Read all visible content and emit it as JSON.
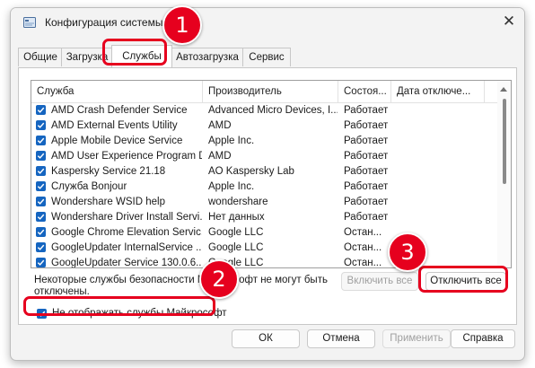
{
  "window": {
    "title": "Конфигурация системы",
    "close_glyph": "✕"
  },
  "tabs": [
    "Общие",
    "Загрузка",
    "Службы",
    "Автозагрузка",
    "Сервис"
  ],
  "active_tab": "Службы",
  "columns": [
    "Служба",
    "Производитель",
    "Состоя...",
    "Дата отключе..."
  ],
  "services": [
    {
      "name": "AMD Crash Defender Service",
      "vendor": "Advanced Micro Devices, I...",
      "status": "Работает",
      "checked": true
    },
    {
      "name": "AMD External Events Utility",
      "vendor": "AMD",
      "status": "Работает",
      "checked": true
    },
    {
      "name": "Apple Mobile Device Service",
      "vendor": "Apple Inc.",
      "status": "Работает",
      "checked": true
    },
    {
      "name": "AMD User Experience Program D...",
      "vendor": "AMD",
      "status": "Работает",
      "checked": true
    },
    {
      "name": "Kaspersky Service 21.18",
      "vendor": "AO Kaspersky Lab",
      "status": "Работает",
      "checked": true
    },
    {
      "name": "Служба Bonjour",
      "vendor": "Apple Inc.",
      "status": "Работает",
      "checked": true
    },
    {
      "name": "Wondershare WSID help",
      "vendor": "wondershare",
      "status": "Работает",
      "checked": true
    },
    {
      "name": "Wondershare Driver Install Servi...",
      "vendor": "Нет данных",
      "status": "Работает",
      "checked": true
    },
    {
      "name": "Google Chrome Elevation Servic...",
      "vendor": "Google LLC",
      "status": "Остан...",
      "checked": true
    },
    {
      "name": "GoogleUpdater InternalService ...",
      "vendor": "Google LLC",
      "status": "Остан...",
      "checked": true
    },
    {
      "name": "GoogleUpdater Service 130.0.6...",
      "vendor": "Google LLC",
      "status": "Остан...",
      "checked": true
    }
  ],
  "note_line1": "Некоторые службы безопасности Майкрософт не могут быть",
  "note_line2": "отключены.",
  "enable_all": "Включить все",
  "disable_all": "Отключить все",
  "hide_ms_label": "Не отображать службы Майкрософт",
  "hide_ms_checked": true,
  "footer": {
    "ok": "ОК",
    "cancel": "Отмена",
    "apply": "Применить",
    "help": "Справка"
  },
  "badges": [
    "1",
    "2",
    "3"
  ],
  "colors": {
    "accent": "#1565c0",
    "highlight": "#e6001e"
  }
}
